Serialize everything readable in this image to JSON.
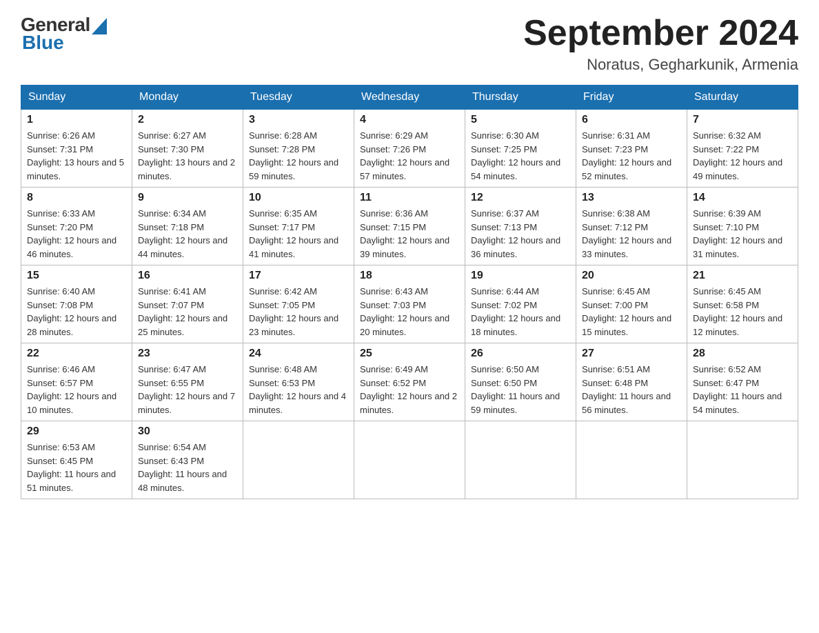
{
  "logo": {
    "general": "General",
    "blue": "Blue"
  },
  "title": {
    "month_year": "September 2024",
    "location": "Noratus, Gegharkunik, Armenia"
  },
  "headers": [
    "Sunday",
    "Monday",
    "Tuesday",
    "Wednesday",
    "Thursday",
    "Friday",
    "Saturday"
  ],
  "weeks": [
    [
      {
        "day": "1",
        "sunrise": "Sunrise: 6:26 AM",
        "sunset": "Sunset: 7:31 PM",
        "daylight": "Daylight: 13 hours and 5 minutes."
      },
      {
        "day": "2",
        "sunrise": "Sunrise: 6:27 AM",
        "sunset": "Sunset: 7:30 PM",
        "daylight": "Daylight: 13 hours and 2 minutes."
      },
      {
        "day": "3",
        "sunrise": "Sunrise: 6:28 AM",
        "sunset": "Sunset: 7:28 PM",
        "daylight": "Daylight: 12 hours and 59 minutes."
      },
      {
        "day": "4",
        "sunrise": "Sunrise: 6:29 AM",
        "sunset": "Sunset: 7:26 PM",
        "daylight": "Daylight: 12 hours and 57 minutes."
      },
      {
        "day": "5",
        "sunrise": "Sunrise: 6:30 AM",
        "sunset": "Sunset: 7:25 PM",
        "daylight": "Daylight: 12 hours and 54 minutes."
      },
      {
        "day": "6",
        "sunrise": "Sunrise: 6:31 AM",
        "sunset": "Sunset: 7:23 PM",
        "daylight": "Daylight: 12 hours and 52 minutes."
      },
      {
        "day": "7",
        "sunrise": "Sunrise: 6:32 AM",
        "sunset": "Sunset: 7:22 PM",
        "daylight": "Daylight: 12 hours and 49 minutes."
      }
    ],
    [
      {
        "day": "8",
        "sunrise": "Sunrise: 6:33 AM",
        "sunset": "Sunset: 7:20 PM",
        "daylight": "Daylight: 12 hours and 46 minutes."
      },
      {
        "day": "9",
        "sunrise": "Sunrise: 6:34 AM",
        "sunset": "Sunset: 7:18 PM",
        "daylight": "Daylight: 12 hours and 44 minutes."
      },
      {
        "day": "10",
        "sunrise": "Sunrise: 6:35 AM",
        "sunset": "Sunset: 7:17 PM",
        "daylight": "Daylight: 12 hours and 41 minutes."
      },
      {
        "day": "11",
        "sunrise": "Sunrise: 6:36 AM",
        "sunset": "Sunset: 7:15 PM",
        "daylight": "Daylight: 12 hours and 39 minutes."
      },
      {
        "day": "12",
        "sunrise": "Sunrise: 6:37 AM",
        "sunset": "Sunset: 7:13 PM",
        "daylight": "Daylight: 12 hours and 36 minutes."
      },
      {
        "day": "13",
        "sunrise": "Sunrise: 6:38 AM",
        "sunset": "Sunset: 7:12 PM",
        "daylight": "Daylight: 12 hours and 33 minutes."
      },
      {
        "day": "14",
        "sunrise": "Sunrise: 6:39 AM",
        "sunset": "Sunset: 7:10 PM",
        "daylight": "Daylight: 12 hours and 31 minutes."
      }
    ],
    [
      {
        "day": "15",
        "sunrise": "Sunrise: 6:40 AM",
        "sunset": "Sunset: 7:08 PM",
        "daylight": "Daylight: 12 hours and 28 minutes."
      },
      {
        "day": "16",
        "sunrise": "Sunrise: 6:41 AM",
        "sunset": "Sunset: 7:07 PM",
        "daylight": "Daylight: 12 hours and 25 minutes."
      },
      {
        "day": "17",
        "sunrise": "Sunrise: 6:42 AM",
        "sunset": "Sunset: 7:05 PM",
        "daylight": "Daylight: 12 hours and 23 minutes."
      },
      {
        "day": "18",
        "sunrise": "Sunrise: 6:43 AM",
        "sunset": "Sunset: 7:03 PM",
        "daylight": "Daylight: 12 hours and 20 minutes."
      },
      {
        "day": "19",
        "sunrise": "Sunrise: 6:44 AM",
        "sunset": "Sunset: 7:02 PM",
        "daylight": "Daylight: 12 hours and 18 minutes."
      },
      {
        "day": "20",
        "sunrise": "Sunrise: 6:45 AM",
        "sunset": "Sunset: 7:00 PM",
        "daylight": "Daylight: 12 hours and 15 minutes."
      },
      {
        "day": "21",
        "sunrise": "Sunrise: 6:45 AM",
        "sunset": "Sunset: 6:58 PM",
        "daylight": "Daylight: 12 hours and 12 minutes."
      }
    ],
    [
      {
        "day": "22",
        "sunrise": "Sunrise: 6:46 AM",
        "sunset": "Sunset: 6:57 PM",
        "daylight": "Daylight: 12 hours and 10 minutes."
      },
      {
        "day": "23",
        "sunrise": "Sunrise: 6:47 AM",
        "sunset": "Sunset: 6:55 PM",
        "daylight": "Daylight: 12 hours and 7 minutes."
      },
      {
        "day": "24",
        "sunrise": "Sunrise: 6:48 AM",
        "sunset": "Sunset: 6:53 PM",
        "daylight": "Daylight: 12 hours and 4 minutes."
      },
      {
        "day": "25",
        "sunrise": "Sunrise: 6:49 AM",
        "sunset": "Sunset: 6:52 PM",
        "daylight": "Daylight: 12 hours and 2 minutes."
      },
      {
        "day": "26",
        "sunrise": "Sunrise: 6:50 AM",
        "sunset": "Sunset: 6:50 PM",
        "daylight": "Daylight: 11 hours and 59 minutes."
      },
      {
        "day": "27",
        "sunrise": "Sunrise: 6:51 AM",
        "sunset": "Sunset: 6:48 PM",
        "daylight": "Daylight: 11 hours and 56 minutes."
      },
      {
        "day": "28",
        "sunrise": "Sunrise: 6:52 AM",
        "sunset": "Sunset: 6:47 PM",
        "daylight": "Daylight: 11 hours and 54 minutes."
      }
    ],
    [
      {
        "day": "29",
        "sunrise": "Sunrise: 6:53 AM",
        "sunset": "Sunset: 6:45 PM",
        "daylight": "Daylight: 11 hours and 51 minutes."
      },
      {
        "day": "30",
        "sunrise": "Sunrise: 6:54 AM",
        "sunset": "Sunset: 6:43 PM",
        "daylight": "Daylight: 11 hours and 48 minutes."
      },
      {
        "day": "",
        "sunrise": "",
        "sunset": "",
        "daylight": ""
      },
      {
        "day": "",
        "sunrise": "",
        "sunset": "",
        "daylight": ""
      },
      {
        "day": "",
        "sunrise": "",
        "sunset": "",
        "daylight": ""
      },
      {
        "day": "",
        "sunrise": "",
        "sunset": "",
        "daylight": ""
      },
      {
        "day": "",
        "sunrise": "",
        "sunset": "",
        "daylight": ""
      }
    ]
  ]
}
